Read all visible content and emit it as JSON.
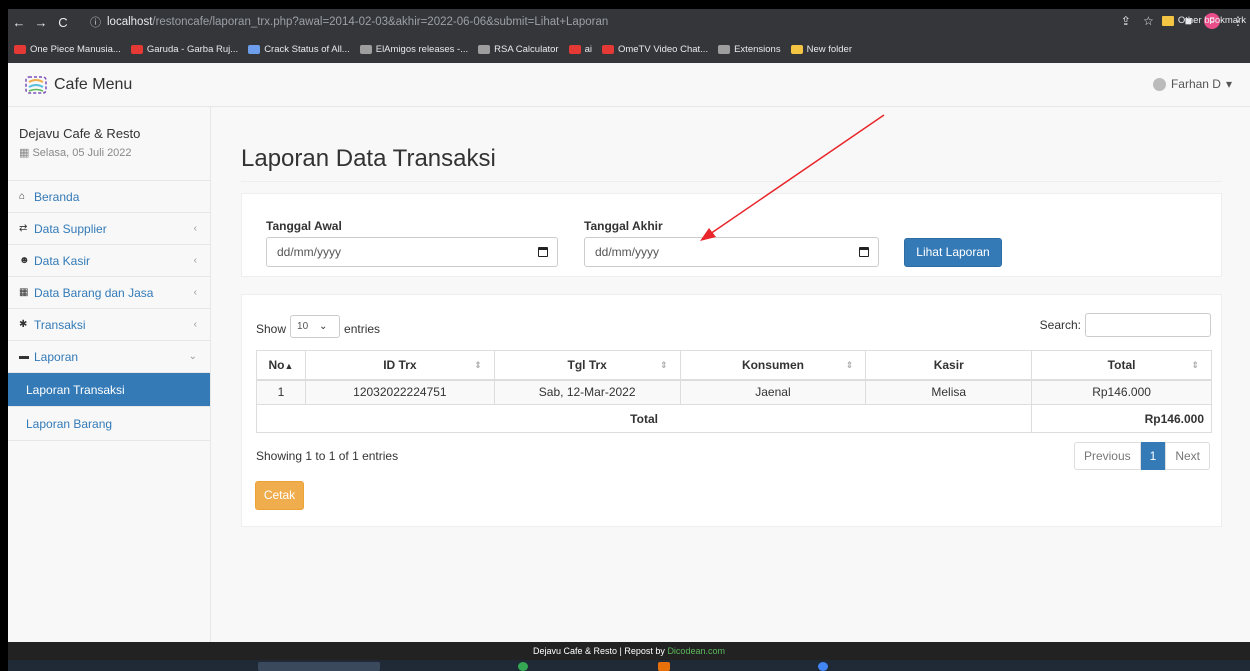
{
  "browser": {
    "url_host": "localhost",
    "url_path": "/restoncafe/laporan_trx.php?awal=2014-02-03&akhir=2022-06-06&submit=Lihat+Laporan",
    "profile_initial": "F",
    "bookmarks": [
      {
        "label": "One Piece Manusia...",
        "color": "#e53935"
      },
      {
        "label": "Garuda - Garba Ruj...",
        "color": "#e53935"
      },
      {
        "label": "Crack Status of All...",
        "color": "#6d9eeb"
      },
      {
        "label": "ElAmigos releases -...",
        "color": "#9e9e9e"
      },
      {
        "label": "RSA Calculator",
        "color": "#9e9e9e"
      },
      {
        "label": "ai",
        "color": "#e53935"
      },
      {
        "label": "OmeTV Video Chat...",
        "color": "#e53935"
      },
      {
        "label": "Extensions",
        "color": "#9e9e9e"
      },
      {
        "label": "New folder",
        "color": "#f4c542"
      }
    ],
    "other_bookmarks": "Other bookmark"
  },
  "nav": {
    "brand": "Cafe Menu",
    "user": "Farhan D"
  },
  "sidebar": {
    "store_name": "Dejavu Cafe & Resto",
    "date": "Selasa, 05 Juli 2022",
    "items": [
      {
        "label": "Beranda",
        "icon": "home-icon",
        "chevron": ""
      },
      {
        "label": "Data Supplier",
        "icon": "share-icon",
        "chevron": "‹"
      },
      {
        "label": "Data Kasir",
        "icon": "users-icon",
        "chevron": "‹"
      },
      {
        "label": "Data Barang dan Jasa",
        "icon": "grid-icon",
        "chevron": "‹"
      },
      {
        "label": "Transaksi",
        "icon": "gear-icon",
        "chevron": "‹"
      },
      {
        "label": "Laporan",
        "icon": "folder-icon",
        "chevron": "⌄"
      }
    ],
    "subitems": [
      {
        "label": "Laporan Transaksi",
        "active": true
      },
      {
        "label": "Laporan Barang",
        "active": false
      }
    ]
  },
  "main": {
    "title": "Laporan Data Transaksi",
    "form": {
      "start_label": "Tanggal Awal",
      "start_placeholder": "dd/mm/yyyy",
      "end_label": "Tanggal Akhir",
      "end_placeholder": "dd/mm/yyyy",
      "submit": "Lihat Laporan"
    },
    "table": {
      "show": "Show",
      "entries_value": "10",
      "entries": "entries",
      "search_label": "Search:",
      "columns": [
        "No",
        "ID Trx",
        "Tgl Trx",
        "Konsumen",
        "Kasir",
        "Total"
      ],
      "rows": [
        [
          "1",
          "12032022224751",
          "Sab, 12-Mar-2022",
          "Jaenal",
          "Melisa",
          "Rp146.000"
        ]
      ],
      "total_label": "Total",
      "total_value": "Rp146.000",
      "info": "Showing 1 to 1 of 1 entries",
      "prev": "Previous",
      "page": "1",
      "next": "Next"
    },
    "print_button": "Cetak"
  },
  "footer": {
    "text": "Dejavu Cafe & Resto | Repost by",
    "link": "Dicodean.com"
  },
  "colors": {
    "primary": "#337ab7",
    "warning": "#f0ad4e",
    "annotation_arrow": "#e8262b"
  }
}
